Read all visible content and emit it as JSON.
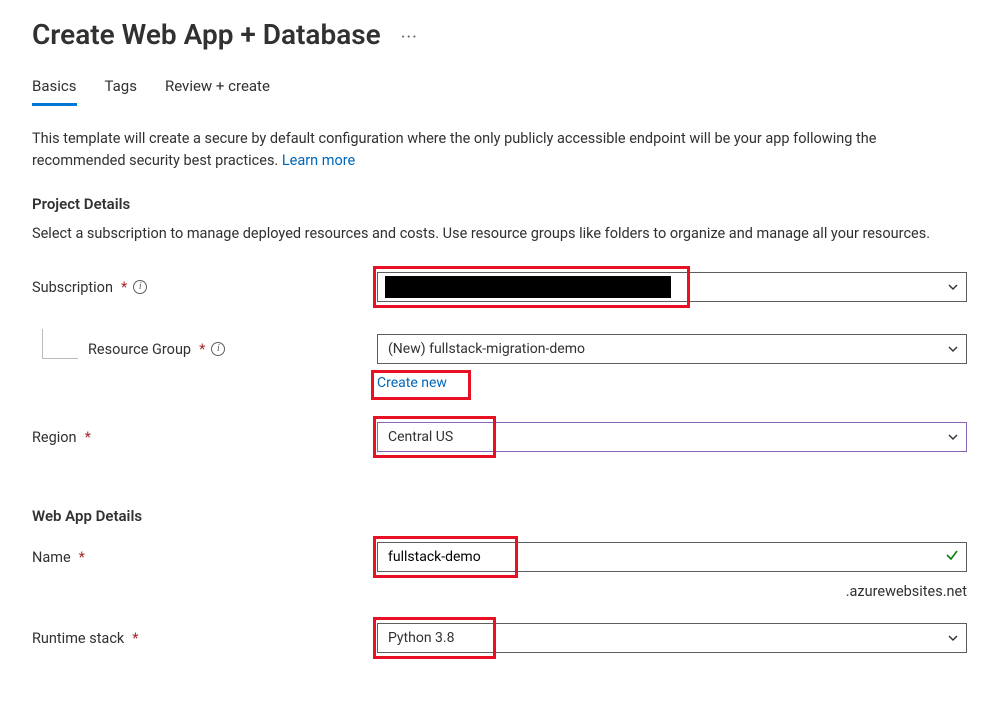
{
  "title": "Create Web App + Database",
  "more_label": "···",
  "tabs": {
    "basics": "Basics",
    "tags": "Tags",
    "review": "Review + create"
  },
  "intro_text": "This template will create a secure by default configuration where the only publicly accessible endpoint will be your app following the recommended security best practices.  ",
  "learn_more": "Learn more",
  "project": {
    "heading": "Project Details",
    "description": "Select a subscription to manage deployed resources and costs. Use resource groups like folders to organize and manage all your resources.",
    "subscription_label": "Subscription",
    "subscription_value": "",
    "resource_group_label": "Resource Group",
    "resource_group_value": "(New) fullstack-migration-demo",
    "create_new": "Create new",
    "region_label": "Region",
    "region_value": "Central US"
  },
  "webapp": {
    "heading": "Web App Details",
    "name_label": "Name",
    "name_value": "fullstack-demo",
    "domain_suffix": ".azurewebsites.net",
    "runtime_label": "Runtime stack",
    "runtime_value": "Python 3.8"
  }
}
